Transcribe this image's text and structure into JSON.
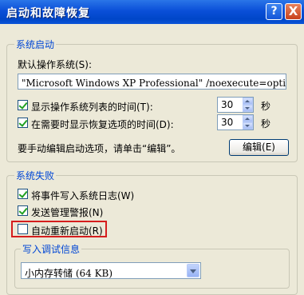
{
  "window": {
    "title": "启动和故障恢复",
    "help_glyph": "?",
    "close_glyph": "X"
  },
  "startup": {
    "group_title": "系统启动",
    "default_os_label": "默认操作系统(S):",
    "default_os_value": "\"Microsoft Windows XP Professional\" /noexecute=optin",
    "show_os_list": {
      "label": "显示操作系统列表的时间(T):",
      "checked": true,
      "value": "30",
      "unit": "秒"
    },
    "show_recovery": {
      "label": "在需要时显示恢复选项的时间(D):",
      "checked": true,
      "value": "30",
      "unit": "秒"
    },
    "edit_hint": "要手动编辑启动选项，请单击“编辑”。",
    "edit_button": "编辑(E)"
  },
  "failure": {
    "group_title": "系统失败",
    "write_event": {
      "label": "将事件写入系统日志(W)",
      "checked": true
    },
    "send_alert": {
      "label": "发送管理警报(N)",
      "checked": true
    },
    "auto_restart": {
      "label": "自动重新启动(R)",
      "checked": false
    },
    "debug_group_title": "写入调试信息",
    "debug_value": "小内存转储 (64 KB)"
  },
  "colors": {
    "titlebar": "#0A4FD8",
    "group_title": "#0046D5",
    "highlight": "#D51D1D",
    "checkmark": "#21A121"
  }
}
